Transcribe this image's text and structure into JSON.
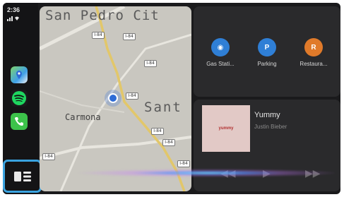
{
  "status": {
    "time": "2:36"
  },
  "sidebar": {
    "apps": [
      {
        "name": "Maps",
        "icon": "maps-icon"
      },
      {
        "name": "Spotify",
        "icon": "spotify-icon"
      },
      {
        "name": "Phone",
        "icon": "phone-icon"
      }
    ],
    "dashboard_icon": "dashboard-icon"
  },
  "map": {
    "place_top": "San Pedro Cit",
    "place_right": "Sant",
    "town": "Carmona",
    "shields": [
      "I-84",
      "I-84",
      "I-84",
      "I-84",
      "I-84",
      "I-84",
      "I-84",
      "I-84"
    ]
  },
  "suggestions": [
    {
      "label": "Gas Stati...",
      "glyph": "◉",
      "color": "#2f7fd6"
    },
    {
      "label": "Parking",
      "glyph": "P",
      "color": "#2f7fd6"
    },
    {
      "label": "Restaura...",
      "glyph": "R",
      "color": "#e07a2a"
    }
  ],
  "now_playing": {
    "song": "Yummy",
    "artist": "Justin Bieber",
    "art_text": "yummy"
  },
  "colors": {
    "accent": "#3aa3e0",
    "screen_bg": "#1a1a1c",
    "panel_bg": "#2a2a2c"
  }
}
